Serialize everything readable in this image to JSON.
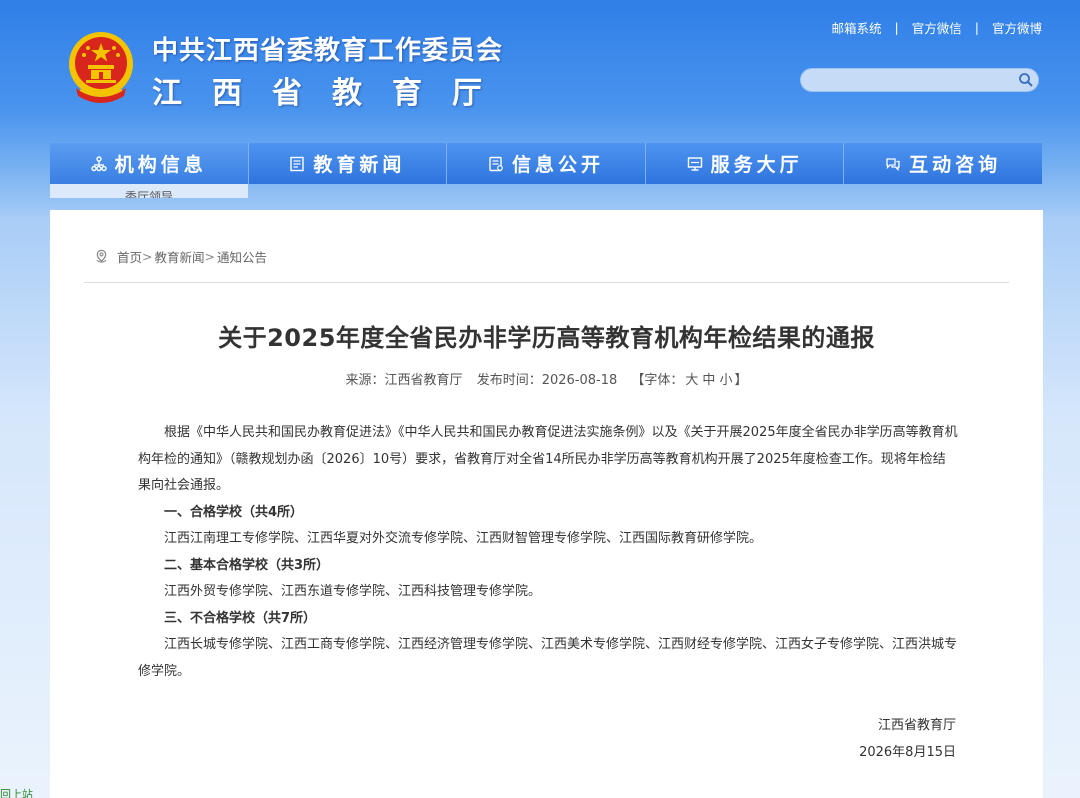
{
  "header": {
    "title_top": "中共江西省委教育工作委员会",
    "title_bottom": "江西省教育厅",
    "links": [
      "邮箱系统",
      "官方微信",
      "官方微博"
    ],
    "search_placeholder": ""
  },
  "nav": {
    "items": [
      {
        "label": "机构信息",
        "icon": "org-icon"
      },
      {
        "label": "教育新闻",
        "icon": "news-icon"
      },
      {
        "label": "信息公开",
        "icon": "info-icon"
      },
      {
        "label": "服务大厅",
        "icon": "service-icon"
      },
      {
        "label": "互动咨询",
        "icon": "chat-icon"
      }
    ],
    "submenu_first": "委厅领导"
  },
  "breadcrumb": [
    "首页",
    "教育新闻",
    "通知公告"
  ],
  "article": {
    "title": "关于2025年度全省民办非学历高等教育机构年检结果的通报",
    "source_label": "来源：江西省教育厅",
    "date_label": "发布时间：2026-08-18",
    "font_label_prefix": "【字体：",
    "font_sizes": [
      "大",
      "中",
      "小"
    ],
    "font_label_suffix": "】",
    "intro": "根据《中华人民共和国民办教育促进法》《中华人民共和国民办教育促进法实施条例》以及《关于开展2025年度全省民办非学历高等教育机构年检的通知》（赣教规划办函〔2026〕10号）要求，省教育厅对全省14所民办非学历高等教育机构开展了2025年度检查工作。现将年检结果向社会通报。",
    "sections": [
      {
        "heading": "一、合格学校（共4所）",
        "list": "江西江南理工专修学院、江西华夏对外交流专修学院、江西财智管理专修学院、江西国际教育研修学院。"
      },
      {
        "heading": "二、基本合格学校（共3所）",
        "list": "江西外贸专修学院、江西东道专修学院、江西科技管理专修学院。"
      },
      {
        "heading": "三、不合格学校（共7所）",
        "list": "江西长城专修学院、江西工商专修学院、江西经济管理专修学院、江西美术专修学院、江西财经专修学院、江西女子专修学院、江西洪城专修学院。"
      }
    ],
    "signature": "江西省教育厅",
    "sign_date": "2026年8月15日"
  },
  "corner_text": "回上站",
  "colors": {
    "header_blue": "#2f7fe8",
    "nav_blue": "#3a7fe2",
    "emblem_red": "#d8261c",
    "emblem_gold": "#f5c400"
  }
}
